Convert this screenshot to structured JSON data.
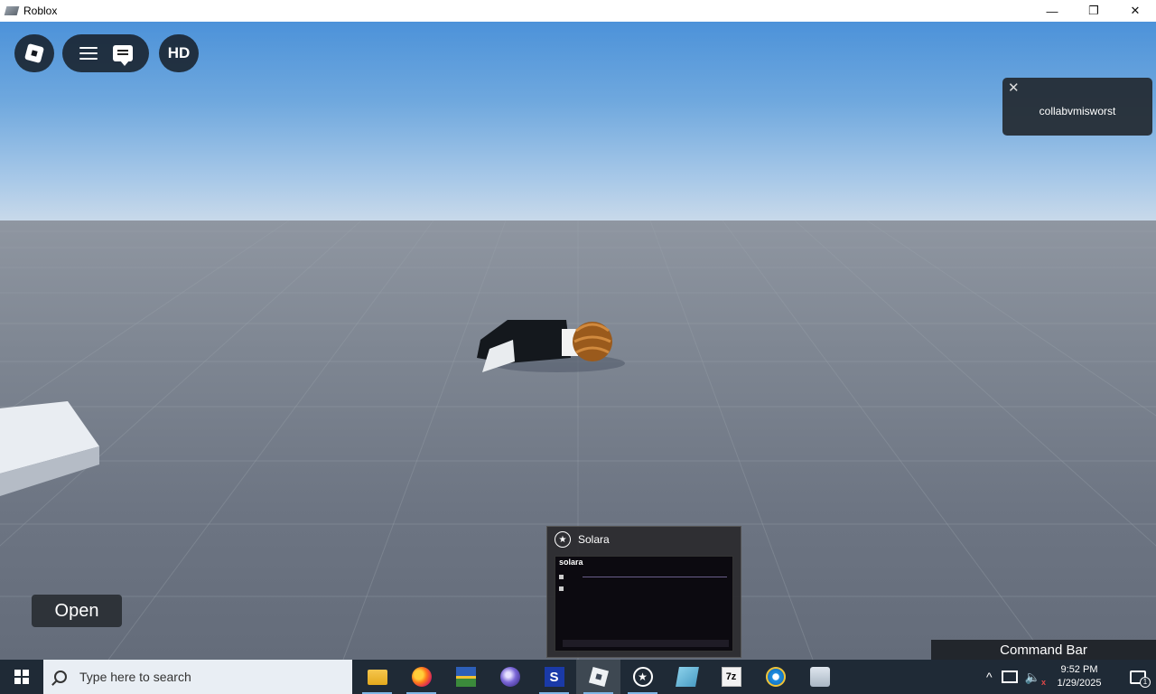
{
  "window": {
    "title": "Roblox",
    "controls": [
      "—",
      "❐",
      "✕"
    ]
  },
  "game": {
    "top_buttons": {
      "hd_label": "HD"
    },
    "notification": {
      "close": "✕",
      "text": "collabvmisworst"
    },
    "open_button": "Open",
    "command_bar": "Command Bar"
  },
  "thumbnail": {
    "title": "Solara",
    "icon": "star-icon",
    "preview_title": "solara"
  },
  "taskbar": {
    "search_placeholder": "Type here to search",
    "apps": [
      {
        "name": "file-explorer-icon"
      },
      {
        "name": "firefox-icon"
      },
      {
        "name": "photos-icon"
      },
      {
        "name": "tor-orb-icon"
      },
      {
        "name": "s-app-icon",
        "label": "S"
      },
      {
        "name": "roblox-icon"
      },
      {
        "name": "solara-star-icon"
      },
      {
        "name": "book-icon"
      },
      {
        "name": "7zip-icon",
        "label": "7z"
      },
      {
        "name": "internet-explorer-icon"
      },
      {
        "name": "camera-icon"
      }
    ],
    "tray": {
      "chevron": "^",
      "volume": "🔈",
      "mute_mark": "x"
    },
    "clock": {
      "time": "9:52 PM",
      "date": "1/29/2025"
    },
    "notification_count": "1"
  }
}
